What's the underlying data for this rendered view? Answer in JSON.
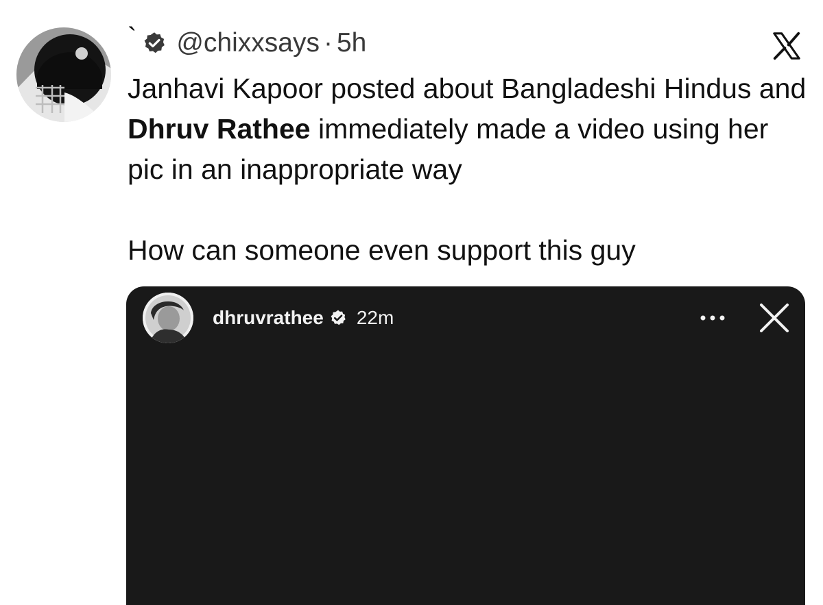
{
  "tweet": {
    "display_name": "`",
    "handle": "@chixxsays",
    "separator": "·",
    "time": "5h",
    "body": {
      "line1_a": "Janhavi Kapoor posted about Bangladeshi Hindus and ",
      "line1_bold": "Dhruv Rathee",
      "line1_b": " immediately made a video using her pic in an inappropriate way",
      "line2": "How can someone even support this guy"
    }
  },
  "story": {
    "username": "dhruvrathee",
    "time": "22m"
  },
  "icons": {
    "verified": "verified-badge-icon",
    "x_logo": "x-logo-icon",
    "more": "more-dots-icon",
    "close": "close-icon"
  },
  "colors": {
    "text": "#111111",
    "muted": "#3a3a3a",
    "card_background": "#191919",
    "card_text": "#f2f2f2"
  }
}
